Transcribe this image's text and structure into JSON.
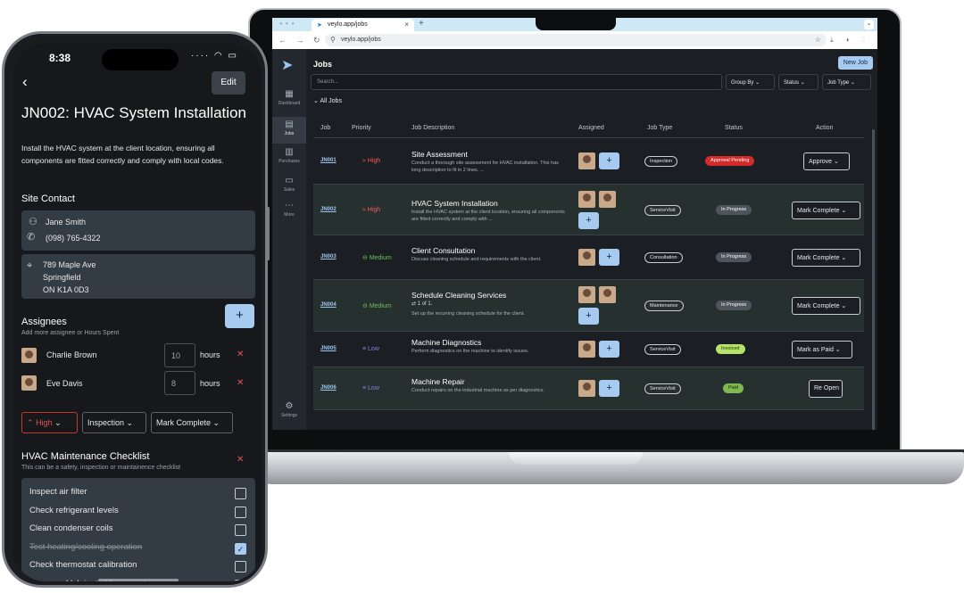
{
  "browser": {
    "tab_title": "veylo.app/jobs",
    "url": "veylo.app/jobs"
  },
  "app": {
    "title": "Jobs",
    "new_job_label": "New Job",
    "search_placeholder": "Search...",
    "filters": [
      "Group By",
      "Status",
      "Job Type"
    ],
    "group_label": "All Jobs",
    "sidebar": [
      {
        "label": "Dashboard",
        "icon": "dashboard-icon"
      },
      {
        "label": "Jobs",
        "icon": "clipboard-icon"
      },
      {
        "label": "Purchases",
        "icon": "receipt-icon"
      },
      {
        "label": "Sales",
        "icon": "card-icon"
      },
      {
        "label": "More",
        "icon": "more-icon"
      },
      {
        "label": "Settings",
        "icon": "gear-icon"
      }
    ],
    "columns": [
      "Job",
      "Priority",
      "Job Description",
      "Assigned",
      "Job Type",
      "Status",
      "Action"
    ],
    "rows": [
      {
        "job": "JN001",
        "priority": "High",
        "prio_class": "high",
        "title": "Site Assessment",
        "desc": "Conduct a thorough site assessment for HVAC installation. This has long description to fit in 2 lines. ...",
        "extra": "",
        "job_type": "Inspection",
        "status": "Approval Pending",
        "status_class": "st-pending",
        "action": "Approve",
        "avatars": 1
      },
      {
        "job": "JN002",
        "priority": "High",
        "prio_class": "high",
        "title": "HVAC System Installation",
        "desc": "Install the HVAC system at the client location, ensuring all components are fitted correctly and comply with ...",
        "extra": "",
        "job_type": "ServiceVisit",
        "status": "In Progress",
        "status_class": "st-progress",
        "action": "Mark Complete",
        "avatars": 2
      },
      {
        "job": "JN003",
        "priority": "Medium",
        "prio_class": "medium",
        "title": "Client Consultation",
        "desc": "Discuss cleaning schedule and requirements with the client.",
        "extra": "",
        "job_type": "Consultation",
        "status": "In Progress",
        "status_class": "st-progress",
        "action": "Mark Complete",
        "avatars": 1
      },
      {
        "job": "JN004",
        "priority": "Medium",
        "prio_class": "medium",
        "title": "Schedule Cleaning Services",
        "desc": "Set up the recurring cleaning schedule for the client.",
        "extra": "1 of 1.",
        "job_type": "Maintenance",
        "status": "In Progress",
        "status_class": "st-progress",
        "action": "Mark Complete",
        "avatars": 2
      },
      {
        "job": "JN005",
        "priority": "Low",
        "prio_class": "low",
        "title": "Machine Diagnostics",
        "desc": "Perform diagnostics on the machine to identify issues.",
        "extra": "",
        "job_type": "ServiceVisit",
        "status": "Invoiced",
        "status_class": "st-invoiced",
        "action": "Mark as Paid",
        "avatars": 1
      },
      {
        "job": "JN006",
        "priority": "Low",
        "prio_class": "low",
        "title": "Machine Repair",
        "desc": "Conduct repairs on the industrial machine as per diagnostics.",
        "extra": "",
        "job_type": "ServiceVisit",
        "status": "Paid",
        "status_class": "st-paid",
        "action": "Re Open",
        "avatars": 1
      }
    ]
  },
  "phone": {
    "time": "8:38",
    "edit_label": "Edit",
    "title": "JN002: HVAC System Installation",
    "description": "Install the HVAC system at the client location, ensuring all components are fitted correctly and comply with local codes.",
    "site_contact_heading": "Site Contact",
    "contact_name": "Jane Smith",
    "contact_phone": "(098) 765-4322",
    "address_line1": "789 Maple Ave",
    "address_line2": "Springfield",
    "address_line3": "ON  K1A 0D3",
    "assignees_heading": "Assignees",
    "assignees_sub": "Add more assignee or Hours Spent",
    "assignees": [
      {
        "name": "Charlie Brown",
        "hours": "10",
        "unit": "hours"
      },
      {
        "name": "Eve Davis",
        "hours": "8",
        "unit": "hours"
      }
    ],
    "priority_value": "High",
    "type_value": "Inspection",
    "action_value": "Mark Complete",
    "checklist_heading": "HVAC Maintenance Checklist",
    "checklist_sub": "This can be a safety, inspection or maintainence checklist",
    "checklist": [
      {
        "label": "Inspect air filter",
        "checked": false
      },
      {
        "label": "Check refrigerant levels",
        "checked": false
      },
      {
        "label": "Clean condenser coils",
        "checked": false
      },
      {
        "label": "Test heating/cooling operation",
        "checked": true
      },
      {
        "label": "Check thermostat calibration",
        "checked": false
      },
      {
        "label": "Clean and lubricate blower motor",
        "checked": false
      }
    ]
  }
}
